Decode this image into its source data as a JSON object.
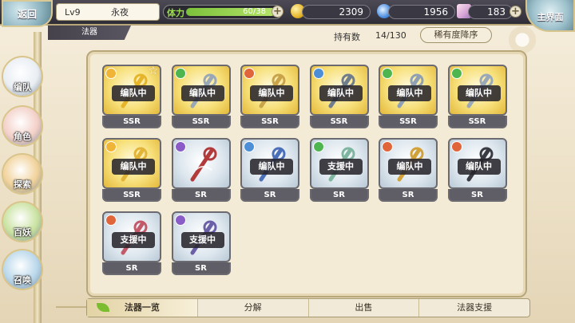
{
  "topbar": {
    "back": "返回",
    "level": "Lv9",
    "player_name": "永夜",
    "stamina_label": "体力",
    "stamina_value": "60/38",
    "stamina_fill": 1.0,
    "gold": "2309",
    "gems": "1956",
    "crystals": "183",
    "home": "主界面"
  },
  "header": {
    "tab": "法器",
    "owned_label": "持有数",
    "owned_value": "14/130",
    "sort": "稀有度降序"
  },
  "sidebar": {
    "items": [
      {
        "label": "编队",
        "color": "#e9eef3"
      },
      {
        "label": "角色",
        "color": "#f3d0c8"
      },
      {
        "label": "探索",
        "color": "#f1d29a"
      },
      {
        "label": "百妖",
        "color": "#c9e2a0"
      },
      {
        "label": "召唤",
        "color": "#b8d7ea"
      }
    ]
  },
  "cards": [
    {
      "rarity": "SSR",
      "status": "编队中",
      "element": "#f0b437",
      "star": "☆"
    },
    {
      "rarity": "SSR",
      "status": "编队中",
      "element": "#4fb64f"
    },
    {
      "rarity": "SSR",
      "status": "编队中",
      "element": "#e0653a"
    },
    {
      "rarity": "SSR",
      "status": "编队中",
      "element": "#4d8fd6"
    },
    {
      "rarity": "SSR",
      "status": "编队中",
      "element": "#4fb64f"
    },
    {
      "rarity": "SSR",
      "status": "编队中",
      "element": "#4fb64f"
    },
    {
      "rarity": "SSR",
      "status": "编队中",
      "element": "#f0b437"
    },
    {
      "rarity": "SR",
      "status": "",
      "element": "#8a5cc7"
    },
    {
      "rarity": "SR",
      "status": "编队中",
      "element": "#4d8fd6"
    },
    {
      "rarity": "SR",
      "status": "支援中",
      "element": "#4fb64f"
    },
    {
      "rarity": "SR",
      "status": "编队中",
      "element": "#e0653a"
    },
    {
      "rarity": "SR",
      "status": "编队中",
      "element": "#e0653a"
    },
    {
      "rarity": "SR",
      "status": "支援中",
      "element": "#e0653a"
    },
    {
      "rarity": "SR",
      "status": "支援中",
      "element": "#8a5cc7"
    }
  ],
  "bottom": {
    "tabs": [
      {
        "label": "法器一览",
        "active": true
      },
      {
        "label": "分解",
        "active": false
      },
      {
        "label": "出售",
        "active": false
      },
      {
        "label": "法器支援",
        "active": false
      }
    ]
  }
}
